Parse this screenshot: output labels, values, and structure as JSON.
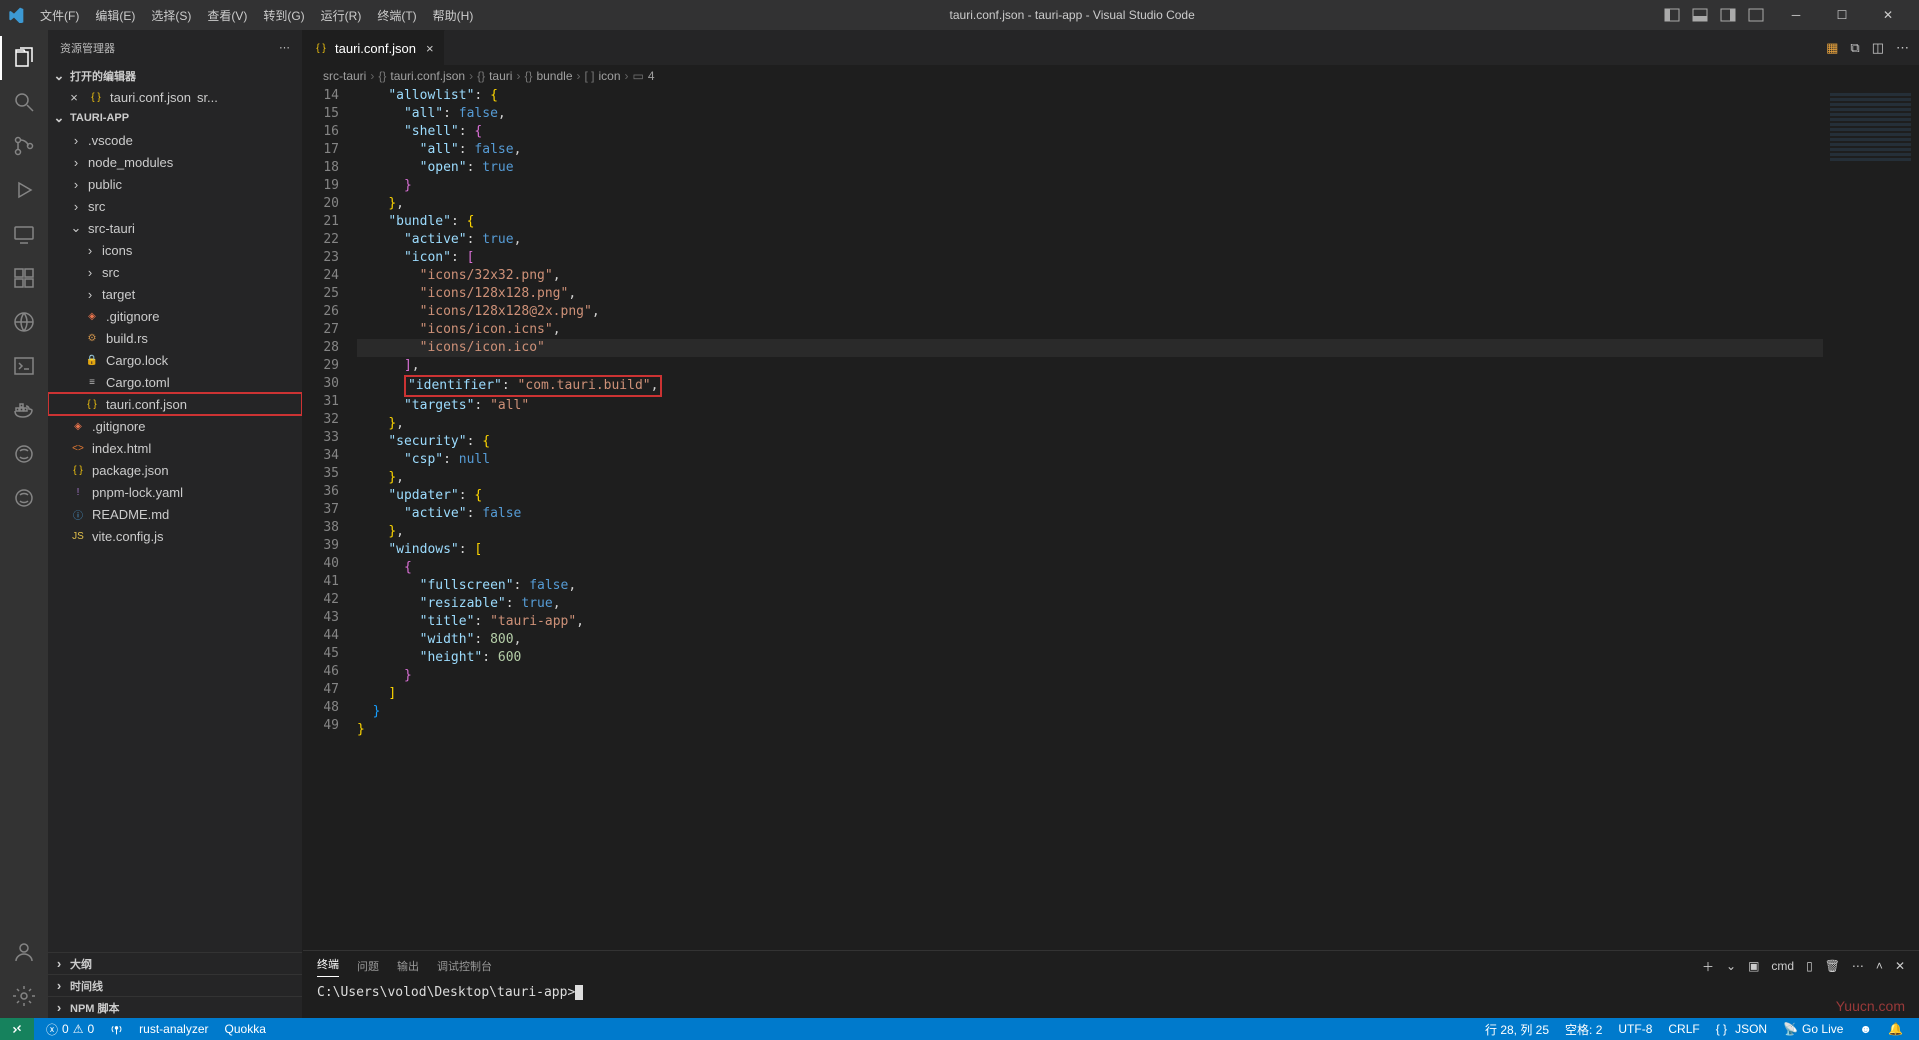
{
  "titlebar": {
    "menus": [
      "文件(F)",
      "编辑(E)",
      "选择(S)",
      "查看(V)",
      "转到(G)",
      "运行(R)",
      "终端(T)",
      "帮助(H)"
    ],
    "title": "tauri.conf.json - tauri-app - Visual Studio Code"
  },
  "sidebar": {
    "title": "资源管理器",
    "openEditorsHeader": "打开的编辑器",
    "openEditors": [
      {
        "name": "tauri.conf.json",
        "hint": "sr..."
      }
    ],
    "projectHeader": "TAURI-APP",
    "tree": [
      {
        "depth": 0,
        "type": "folder",
        "name": ".vscode",
        "open": false
      },
      {
        "depth": 0,
        "type": "folder",
        "name": "node_modules",
        "open": false
      },
      {
        "depth": 0,
        "type": "folder",
        "name": "public",
        "open": false
      },
      {
        "depth": 0,
        "type": "folder",
        "name": "src",
        "open": false
      },
      {
        "depth": 0,
        "type": "folder",
        "name": "src-tauri",
        "open": true
      },
      {
        "depth": 1,
        "type": "folder",
        "name": "icons",
        "open": false
      },
      {
        "depth": 1,
        "type": "folder",
        "name": "src",
        "open": false
      },
      {
        "depth": 1,
        "type": "folder",
        "name": "target",
        "open": false
      },
      {
        "depth": 1,
        "type": "file",
        "name": ".gitignore",
        "icon": "git"
      },
      {
        "depth": 1,
        "type": "file",
        "name": "build.rs",
        "icon": "rust"
      },
      {
        "depth": 1,
        "type": "file",
        "name": "Cargo.lock",
        "icon": "lock"
      },
      {
        "depth": 1,
        "type": "file",
        "name": "Cargo.toml",
        "icon": "toml"
      },
      {
        "depth": 1,
        "type": "file",
        "name": "tauri.conf.json",
        "icon": "json",
        "highlighted": true
      },
      {
        "depth": 0,
        "type": "file",
        "name": ".gitignore",
        "icon": "git"
      },
      {
        "depth": 0,
        "type": "file",
        "name": "index.html",
        "icon": "html"
      },
      {
        "depth": 0,
        "type": "file",
        "name": "package.json",
        "icon": "json"
      },
      {
        "depth": 0,
        "type": "file",
        "name": "pnpm-lock.yaml",
        "icon": "yaml"
      },
      {
        "depth": 0,
        "type": "file",
        "name": "README.md",
        "icon": "info"
      },
      {
        "depth": 0,
        "type": "file",
        "name": "vite.config.js",
        "icon": "js"
      }
    ],
    "bottomSections": [
      "大纲",
      "时间线",
      "NPM 脚本"
    ]
  },
  "tabs": {
    "active": {
      "name": "tauri.conf.json"
    }
  },
  "breadcrumbs": [
    "src-tauri",
    "tauri.conf.json",
    "tauri",
    "bundle",
    "icon",
    "4"
  ],
  "breadcrumbIcons": [
    "",
    "{}",
    "{}",
    "{}",
    "[ ]",
    "▭"
  ],
  "code": {
    "startLine": 14,
    "lines": [
      {
        "n": 14,
        "html": "    <span class='tok-key'>\"allowlist\"</span><span class='tok-punc'>:</span> <span class='tok-brace'>{</span>"
      },
      {
        "n": 15,
        "html": "      <span class='tok-key'>\"all\"</span><span class='tok-punc'>:</span> <span class='tok-bool'>false</span><span class='tok-punc'>,</span>"
      },
      {
        "n": 16,
        "html": "      <span class='tok-key'>\"shell\"</span><span class='tok-punc'>:</span> <span class='tok-brace2'>{</span>"
      },
      {
        "n": 17,
        "html": "        <span class='tok-key'>\"all\"</span><span class='tok-punc'>:</span> <span class='tok-bool'>false</span><span class='tok-punc'>,</span>"
      },
      {
        "n": 18,
        "html": "        <span class='tok-key'>\"open\"</span><span class='tok-punc'>:</span> <span class='tok-bool'>true</span>"
      },
      {
        "n": 19,
        "html": "      <span class='tok-brace2'>}</span>"
      },
      {
        "n": 20,
        "html": "    <span class='tok-brace'>}</span><span class='tok-punc'>,</span>"
      },
      {
        "n": 21,
        "html": "    <span class='tok-key'>\"bundle\"</span><span class='tok-punc'>:</span> <span class='tok-brace'>{</span>"
      },
      {
        "n": 22,
        "html": "      <span class='tok-key'>\"active\"</span><span class='tok-punc'>:</span> <span class='tok-bool'>true</span><span class='tok-punc'>,</span>"
      },
      {
        "n": 23,
        "html": "      <span class='tok-key'>\"icon\"</span><span class='tok-punc'>:</span> <span class='tok-brace2'>[</span>"
      },
      {
        "n": 24,
        "html": "        <span class='tok-str'>\"icons/32x32.png\"</span><span class='tok-punc'>,</span>"
      },
      {
        "n": 25,
        "html": "        <span class='tok-str'>\"icons/128x128.png\"</span><span class='tok-punc'>,</span>"
      },
      {
        "n": 26,
        "html": "        <span class='tok-str'>\"icons/128x128@2x.png\"</span><span class='tok-punc'>,</span>"
      },
      {
        "n": 27,
        "html": "        <span class='tok-str'>\"icons/icon.icns\"</span><span class='tok-punc'>,</span>"
      },
      {
        "n": 28,
        "hl": true,
        "html": "        <span class='tok-str'>\"icons/icon.ico\"</span>"
      },
      {
        "n": 29,
        "html": "      <span class='tok-brace2'>]</span><span class='tok-punc'>,</span>"
      },
      {
        "n": 30,
        "box": true,
        "html": "      <span class='red-box'><span class='tok-key'>\"identifier\"</span><span class='tok-punc'>:</span> <span class='tok-str'>\"com.tauri.build\"</span><span class='tok-punc'>,</span></span>"
      },
      {
        "n": 31,
        "html": "      <span class='tok-key'>\"targets\"</span><span class='tok-punc'>:</span> <span class='tok-str'>\"all\"</span>"
      },
      {
        "n": 32,
        "html": "    <span class='tok-brace'>}</span><span class='tok-punc'>,</span>"
      },
      {
        "n": 33,
        "html": "    <span class='tok-key'>\"security\"</span><span class='tok-punc'>:</span> <span class='tok-brace'>{</span>"
      },
      {
        "n": 34,
        "html": "      <span class='tok-key'>\"csp\"</span><span class='tok-punc'>:</span> <span class='tok-null'>null</span>"
      },
      {
        "n": 35,
        "html": "    <span class='tok-brace'>}</span><span class='tok-punc'>,</span>"
      },
      {
        "n": 36,
        "html": "    <span class='tok-key'>\"updater\"</span><span class='tok-punc'>:</span> <span class='tok-brace'>{</span>"
      },
      {
        "n": 37,
        "html": "      <span class='tok-key'>\"active\"</span><span class='tok-punc'>:</span> <span class='tok-bool'>false</span>"
      },
      {
        "n": 38,
        "html": "    <span class='tok-brace'>}</span><span class='tok-punc'>,</span>"
      },
      {
        "n": 39,
        "html": "    <span class='tok-key'>\"windows\"</span><span class='tok-punc'>:</span> <span class='tok-brace'>[</span>"
      },
      {
        "n": 40,
        "html": "      <span class='tok-brace2'>{</span>"
      },
      {
        "n": 41,
        "html": "        <span class='tok-key'>\"fullscreen\"</span><span class='tok-punc'>:</span> <span class='tok-bool'>false</span><span class='tok-punc'>,</span>"
      },
      {
        "n": 42,
        "html": "        <span class='tok-key'>\"resizable\"</span><span class='tok-punc'>:</span> <span class='tok-bool'>true</span><span class='tok-punc'>,</span>"
      },
      {
        "n": 43,
        "html": "        <span class='tok-key'>\"title\"</span><span class='tok-punc'>:</span> <span class='tok-str'>\"tauri-app\"</span><span class='tok-punc'>,</span>"
      },
      {
        "n": 44,
        "html": "        <span class='tok-key'>\"width\"</span><span class='tok-punc'>:</span> <span class='tok-num'>800</span><span class='tok-punc'>,</span>"
      },
      {
        "n": 45,
        "html": "        <span class='tok-key'>\"height\"</span><span class='tok-punc'>:</span> <span class='tok-num'>600</span>"
      },
      {
        "n": 46,
        "html": "      <span class='tok-brace2'>}</span>"
      },
      {
        "n": 47,
        "html": "    <span class='tok-brace'>]</span>"
      },
      {
        "n": 48,
        "html": "  <span class='tok-brace3'>}</span>"
      },
      {
        "n": 49,
        "html": "<span class='tok-brace'>}</span>"
      }
    ]
  },
  "panel": {
    "tabs": [
      "终端",
      "问题",
      "输出",
      "调试控制台"
    ],
    "activeTab": 0,
    "terminalLabel": "cmd",
    "prompt": "C:\\Users\\volod\\Desktop\\tauri-app>"
  },
  "statusbar": {
    "errors": "0",
    "warnings": "0",
    "rust": "rust-analyzer",
    "quokka": "Quokka",
    "cursor": "行 28, 列 25",
    "spaces": "空格: 2",
    "encoding": "UTF-8",
    "eol": "CRLF",
    "language": "JSON",
    "golive": "Go Live",
    "notify": ""
  },
  "watermark": "Yuucn.com"
}
